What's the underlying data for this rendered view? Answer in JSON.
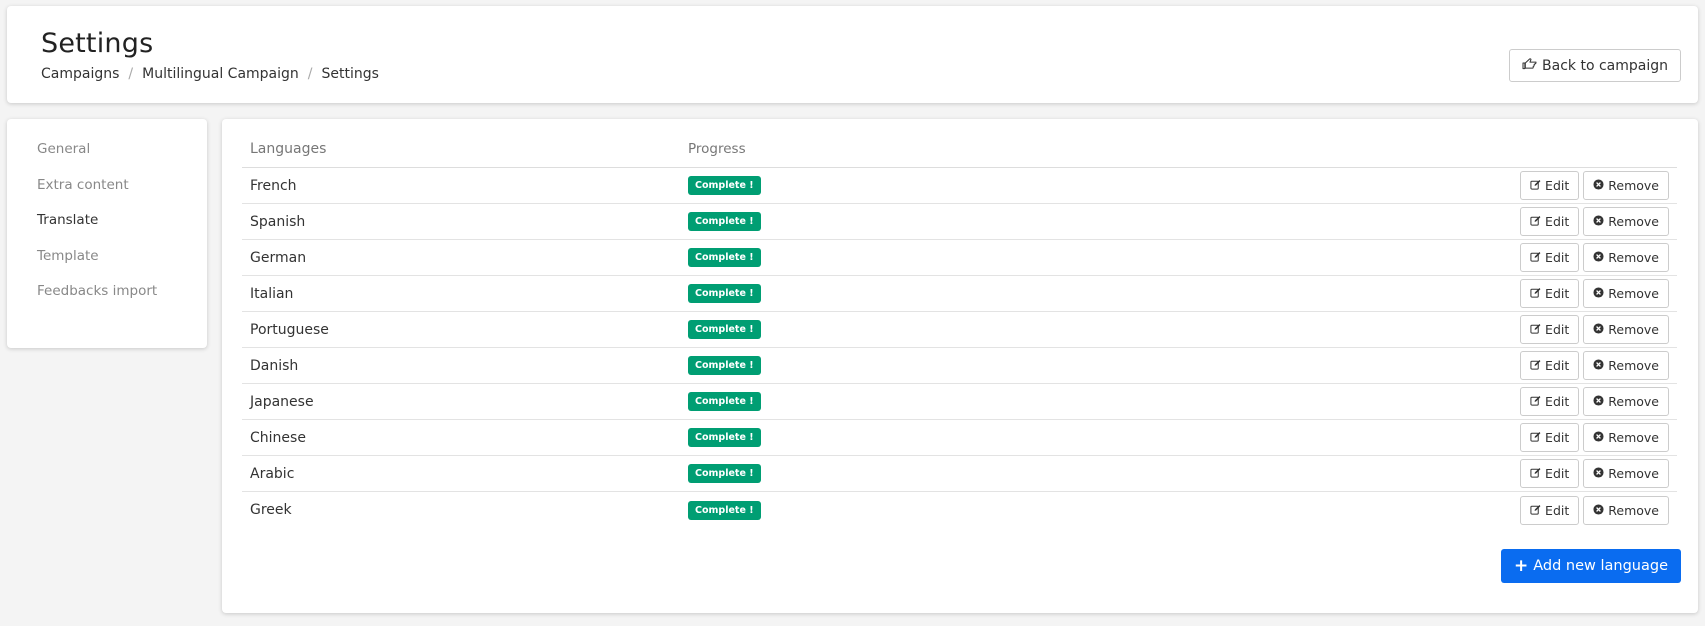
{
  "header": {
    "title": "Settings",
    "breadcrumb": [
      "Campaigns",
      "Multilingual Campaign",
      "Settings"
    ],
    "back_label": "Back to campaign"
  },
  "sidebar": {
    "items": [
      {
        "label": "General",
        "active": false
      },
      {
        "label": "Extra content",
        "active": false
      },
      {
        "label": "Translate",
        "active": true
      },
      {
        "label": "Template",
        "active": false
      },
      {
        "label": "Feedbacks import",
        "active": false
      }
    ]
  },
  "table": {
    "headers": {
      "language": "Languages",
      "progress": "Progress"
    },
    "rows": [
      {
        "language": "French",
        "status": "Complete !"
      },
      {
        "language": "Spanish",
        "status": "Complete !"
      },
      {
        "language": "German",
        "status": "Complete !"
      },
      {
        "language": "Italian",
        "status": "Complete !"
      },
      {
        "language": "Portuguese",
        "status": "Complete !"
      },
      {
        "language": "Danish",
        "status": "Complete !"
      },
      {
        "language": "Japanese",
        "status": "Complete !"
      },
      {
        "language": "Chinese",
        "status": "Complete !"
      },
      {
        "language": "Arabic",
        "status": "Complete !"
      },
      {
        "language": "Greek",
        "status": "Complete !"
      }
    ],
    "edit_label": "Edit",
    "remove_label": "Remove"
  },
  "add_language_label": "Add new language",
  "colors": {
    "accent": "#0a6cf0",
    "badge": "#009e73"
  },
  "icons": {
    "back": "hand-pointer-left-icon",
    "edit": "edit-icon",
    "remove": "times-circle-icon",
    "add": "plus-icon"
  }
}
